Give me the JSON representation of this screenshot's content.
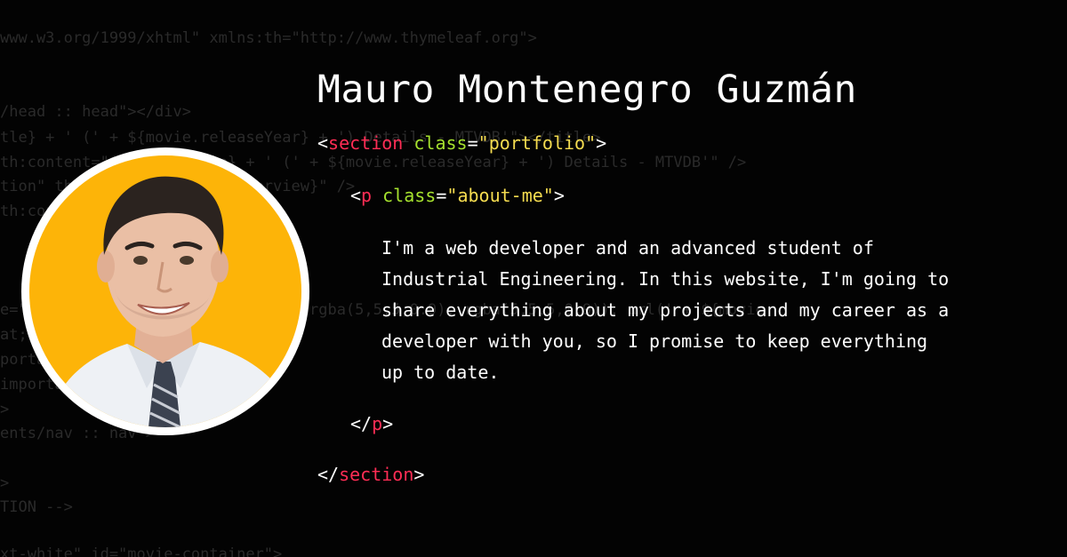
{
  "background_code": [
    "www.w3.org/1999/xhtml\" xmlns:th=\"http://www.thymeleaf.org\">",
    "/head :: head\"></div>",
    "tle} + ' (' + ${movie.releaseYear} + ') Details - MTVDB'\"></title>",
    "th:content=\"${movie.title} + ' (' + ${movie.releaseYear} + ') Details - MTVDB'\" />",
    "tion\" th:content=\"${movie.overview}\" />",
    "th:content=\"${movie.poster}\" />",
    "e=\"   background: linear-gradient(rgba(5,5,5,0.9), rgba(5,5,5,0.9)), url(' + ${movie",
    "at;",
    "portant;",
    "important;",
    ">",
    "ents/nav :: nav\">",
    ">",
    "TION -->",
    "xt-white\" id=\"movie-container\">"
  ],
  "header": {
    "name": "Mauro Montenegro Guzmán"
  },
  "code": {
    "lt": "<",
    "gt": ">",
    "close_open": "</",
    "eq": "=",
    "section_tag": "section",
    "section_attr": "class",
    "section_value": "\"portfolio\"",
    "p_tag": "p",
    "p_attr": "class",
    "p_value": "\"about-me\""
  },
  "about": {
    "text": "I'm a web developer and an advanced student of\nIndustrial Engineering. In this website, I'm going to\nshare everything about my projects and my career as a\ndeveloper with you, so I promise to keep everything\nup to date."
  },
  "avatar": {
    "background_color": "#FDB408",
    "border_color": "#FFFFFF"
  },
  "colors": {
    "tag": "#FF2D55",
    "attribute": "#A6E22E",
    "string": "#F5DC50",
    "text": "#FFFFFF",
    "page_background": "#030303"
  }
}
